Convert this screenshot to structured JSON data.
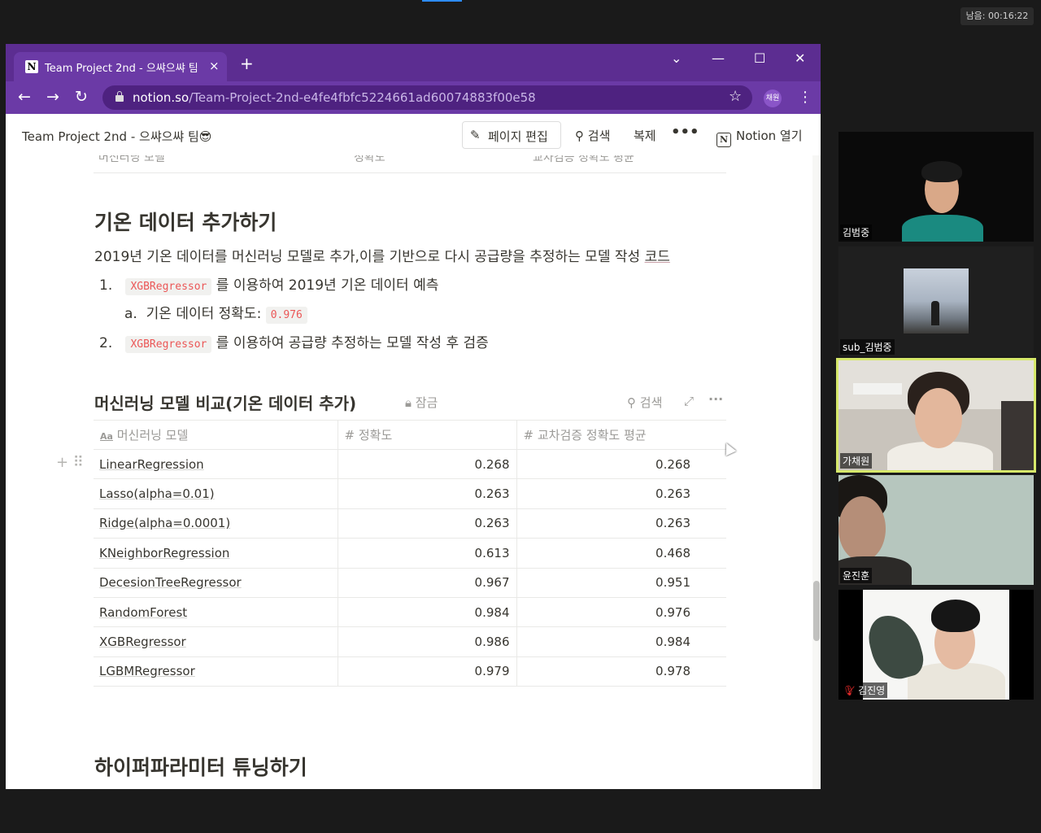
{
  "meeting": {
    "timer": "남음: 00:16:22"
  },
  "browser": {
    "tab_title": "Team Project 2nd - 으쌰으쌰 팀",
    "tab_close": "×",
    "new_tab": "+",
    "url_host": "notion.so",
    "url_path": "/Team-Project-2nd-e4fe4fbfc5224661ad60074883f00e58",
    "profile": "채원"
  },
  "notion": {
    "page_title": "Team Project 2nd - 으쌰으쌰 팀😎",
    "edit_label": "페이지 편집",
    "search_label": "검색",
    "duplicate_label": "복제",
    "open_label": "Notion 열기",
    "ghost_cols": [
      "머신러닝 모델",
      "정확도",
      "교차검증 정확도 평균"
    ],
    "section1_title": "기온 데이터 추가하기",
    "section1_para": "2019년 기온 데이터를 머신러닝 모델로 추가,이를 기반으로 다시 공급량을 추정하는 모델 작성",
    "section1_link": "코드",
    "list": [
      {
        "num": "1.",
        "code": "XGBRegressor",
        "text": "를 이용하여 2019년 기온 데이터 예측"
      },
      {
        "num": "a.",
        "text": "기온 데이터 정확도:",
        "code": "0.976"
      },
      {
        "num": "2.",
        "code": "XGBRegressor",
        "text": "를 이용하여 공급량 추정하는 모델 작성 후 검증"
      }
    ],
    "db_title": "머신러닝 모델 비교(기온 데이터 추가)",
    "db_lock": "잠금",
    "db_search": "검색",
    "db_columns": [
      "머신러닝 모델",
      "정확도",
      "교차검증 정확도 평균"
    ],
    "db_rows": [
      [
        "LinearRegression",
        "0.268",
        "0.268"
      ],
      [
        "Lasso(alpha=0.01)",
        "0.263",
        "0.263"
      ],
      [
        "Ridge(alpha=0.0001)",
        "0.263",
        "0.263"
      ],
      [
        "KNeighborRegression",
        "0.613",
        "0.468"
      ],
      [
        "DecesionTreeRegressor",
        "0.967",
        "0.951"
      ],
      [
        "RandomForest",
        "0.984",
        "0.976"
      ],
      [
        "XGBRegressor",
        "0.986",
        "0.984"
      ],
      [
        "LGBMRegressor",
        "0.979",
        "0.978"
      ]
    ],
    "section2_title": "하이퍼파라미터 튜닝하기"
  },
  "participants": [
    {
      "name": "김범중"
    },
    {
      "name": "sub_김범중"
    },
    {
      "name": "가채원"
    },
    {
      "name": "윤진훈"
    },
    {
      "name": "김진영"
    }
  ],
  "colors": {
    "chrome_purple": "#5c2d91",
    "code_red": "#eb5757",
    "active_speaker": "#d6e86a"
  }
}
